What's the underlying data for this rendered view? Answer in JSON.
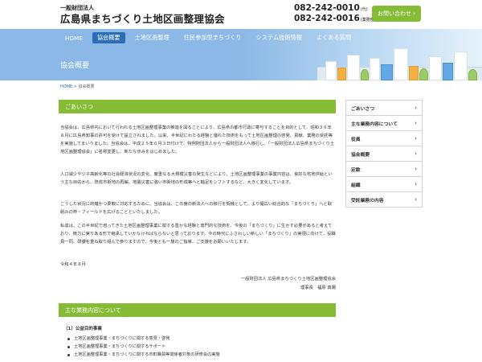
{
  "header": {
    "org_type": "一般財団法人",
    "org_name": "広島県まちづくり土地区画整理協会",
    "phone_main": "082-242-0010",
    "phone_main_tag": "(代)",
    "phone_business": "082-242-0016",
    "phone_business_tag": "(業務部)",
    "contact_button": "お問い合わせ ›"
  },
  "nav": {
    "items": [
      {
        "label": "HOME"
      },
      {
        "label": "協会概要"
      },
      {
        "label": "土地区画整理"
      },
      {
        "label": "住民参加型まちづくり"
      },
      {
        "label": "システム技術情報"
      },
      {
        "label": "よくある質問"
      }
    ],
    "active_index": 1
  },
  "hero": {
    "title": "協会概要"
  },
  "breadcrumb": {
    "home": "HOME",
    "separator": " > ",
    "current": "協会概要"
  },
  "greeting": {
    "heading": "ごあいさつ",
    "p1": "当協会は、広島県内において行われる土地区画整理事業の推進を図ることにより、広島県の都市行政に寄与することを目的として、昭和３６年８月に広島県知事の許可を受けて設立されました。以来、半世紀にわたる経験と優れた技術をもって土地区画整理の啓発、貢献、業務の受託等を実施してまいりました。当協会は、平成２５年６月３日付けで、特例財団法人から一般財団法人へ移行し、「一般財団法人広島県まちづくり土地区画整理協会」に名称変更し、新たな歩みをはじめました。",
    "p2": "人口減少や少子高齢化等の社会経済状況の変化、度重なる大規模災害の発生などにより、土地区画整理事業の事業内容は、良好な宅地供給という主な目的から、既成市街地の再編、地震災害に強い市街地の形成等へと軸足をシフトするなど、大きく変化しています。",
    "p3": "こうした状況に的確かつ柔軟に対応するために、当協会は、この度の新法人への移行を契機として、より幅広い総合的な「まちづくり」へと取組みの枠・フィールドを広げることといたしました。",
    "p4": "私達は、この半世紀で培ってきた土地区画整理事業に関する豊かな経験と専門的な技術を、今後の「まちづくり」に生かす必要があると考えており、微力に実りある形で継承していかなければならないと思っております。今の時代にふさわしい新しい「まちづくり」の実現に向けて、役職員一同、研讃を重ね取り組んで参りますので、今後とも一層のご指導、ご支援をお願いいたします。",
    "date": "令和４年８月",
    "signature_org": "一般財団法人 広島県まちづくり土地区画整理協会",
    "signature_chair": "理事長　福原 真爾"
  },
  "business": {
    "heading": "主な業務内容について",
    "list_title": "（1）公益目的事業",
    "items": [
      "土地区画整理事業・まちづくりに関する意見・啓発",
      "土地区画整理事業・まちづくりに関するサポート",
      "土地区画整理事業・まちづくりに関する市町職員等関係者対象の研修会の実施"
    ]
  },
  "sidebar": {
    "items": [
      {
        "label": "ごあいさつ"
      },
      {
        "label": "主な業務内容について"
      },
      {
        "label": "役員"
      },
      {
        "label": "協会概要"
      },
      {
        "label": "定款"
      },
      {
        "label": "組織"
      },
      {
        "label": "受託業務の内容"
      }
    ],
    "chevron": "›"
  },
  "colors": {
    "accent_green": "#86bb36",
    "nav_active": "#2c6db6",
    "hero_blue": "#8bb8e6"
  }
}
